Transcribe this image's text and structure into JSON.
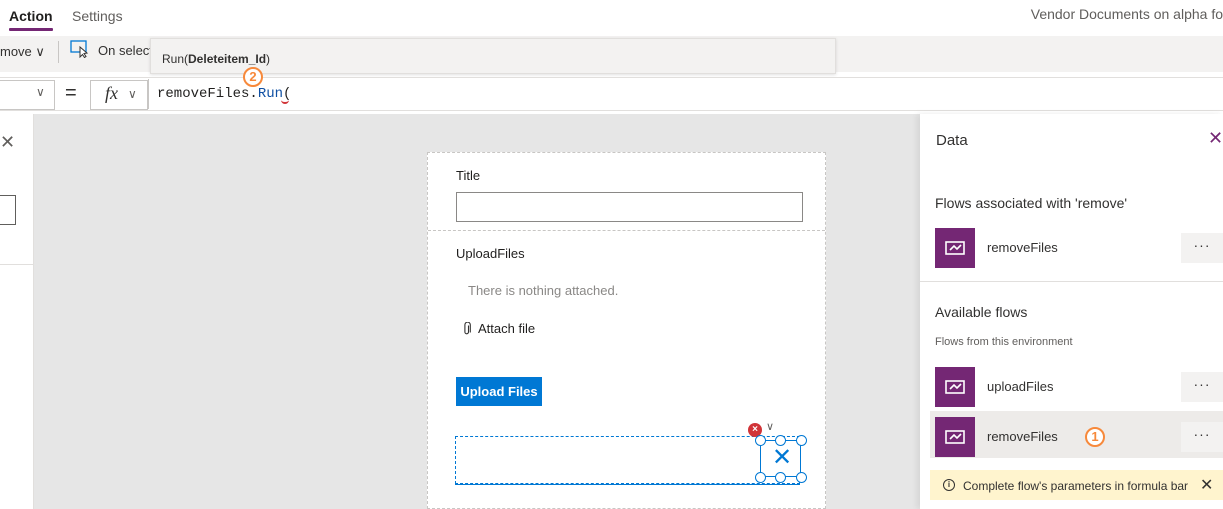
{
  "tabs": {
    "action": "Action",
    "settings": "Settings"
  },
  "app_title": "Vendor Documents on alpha fo",
  "toolbar": {
    "remove_label": "move ∨",
    "on_select_label": "On select"
  },
  "tooltip": {
    "prefix": "Run(",
    "param": "Deleteitem_Id",
    "suffix": ")"
  },
  "formula_bar": {
    "equals": "=",
    "fx": "fx",
    "chevron": "∨",
    "code_prefix": "removeFiles.",
    "code_run": "Run",
    "code_suffix": "("
  },
  "callouts": {
    "one": "1",
    "two": "2"
  },
  "canvas": {
    "title_label": "Title",
    "upload_label": "UploadFiles",
    "nothing_attached": "There is nothing attached.",
    "attach_file": "Attach file",
    "upload_button": "Upload Files",
    "error_glyph": "×",
    "remove_glyph": "✕"
  },
  "data_panel": {
    "title": "Data",
    "close_glyph": "✕",
    "associated_heading": "Flows associated with 'remove'",
    "associated_flows": [
      {
        "name": "removeFiles"
      }
    ],
    "available_heading": "Available flows",
    "environment_subheading": "Flows from this environment",
    "available_flows": [
      {
        "name": "uploadFiles"
      },
      {
        "name": "removeFiles"
      }
    ],
    "more_glyph": "···",
    "warning": {
      "icon": "i",
      "text": "Complete flow's parameters in formula bar",
      "close": "✕"
    }
  },
  "colors": {
    "brand_purple": "#742774",
    "accent_blue": "#0078d4",
    "callout_orange": "#f7893b",
    "warning_bg": "#fff4ce",
    "error_red": "#d13438"
  },
  "icons": {
    "flow": "power-automate-flow-icon",
    "attach": "paperclip-icon",
    "on_select": "on-select-icon",
    "close": "close-icon"
  }
}
